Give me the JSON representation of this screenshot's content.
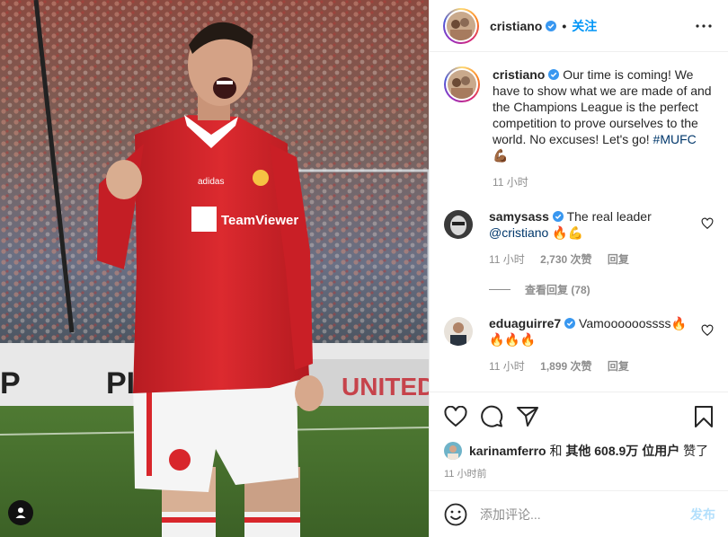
{
  "post": {
    "author": "cristiano",
    "follow_label": "关注",
    "dot": "•"
  },
  "caption": {
    "author": "cristiano",
    "text": "Our time is coming! We have to show what we are made of and the Champions League is the perfect competition to prove ourselves to the world. No excuses! Let's go!",
    "hashtag": "#MUFC",
    "emoji": "💪🏾",
    "time": "11 小时"
  },
  "comments": [
    {
      "author": "samysass",
      "text": "The real leader",
      "mention": "@cristiano",
      "emoji": "🔥💪",
      "time": "11 小时",
      "likes": "2,730 次赞",
      "reply": "回复",
      "view_replies": "查看回复 (78)"
    },
    {
      "author": "eduaguirre7",
      "text": "Vamoooooossss🔥",
      "emoji": "🔥🔥🔥",
      "time": "11 小时",
      "likes": "1,899 次赞",
      "reply": "回复"
    }
  ],
  "likes_line": {
    "user": "karinamferro",
    "and": "和",
    "others": "其他 608.9万 位用户",
    "suffix": "赞了"
  },
  "timestamp": "11 小时前",
  "comment_box": {
    "placeholder": "添加评论...",
    "post_label": "发布"
  },
  "icons": {
    "more": "more-horizontal-icon",
    "like": "heart-icon",
    "comment": "comment-bubble-icon",
    "share": "paper-plane-icon",
    "save": "bookmark-icon",
    "emoji": "smiley-icon",
    "verified": "verified-badge-icon",
    "tag": "user-tag-icon"
  },
  "colors": {
    "accent": "#0095f6",
    "verified": "#3897f0",
    "jersey_red": "#d8262b",
    "muted": "#8e8e8e"
  }
}
